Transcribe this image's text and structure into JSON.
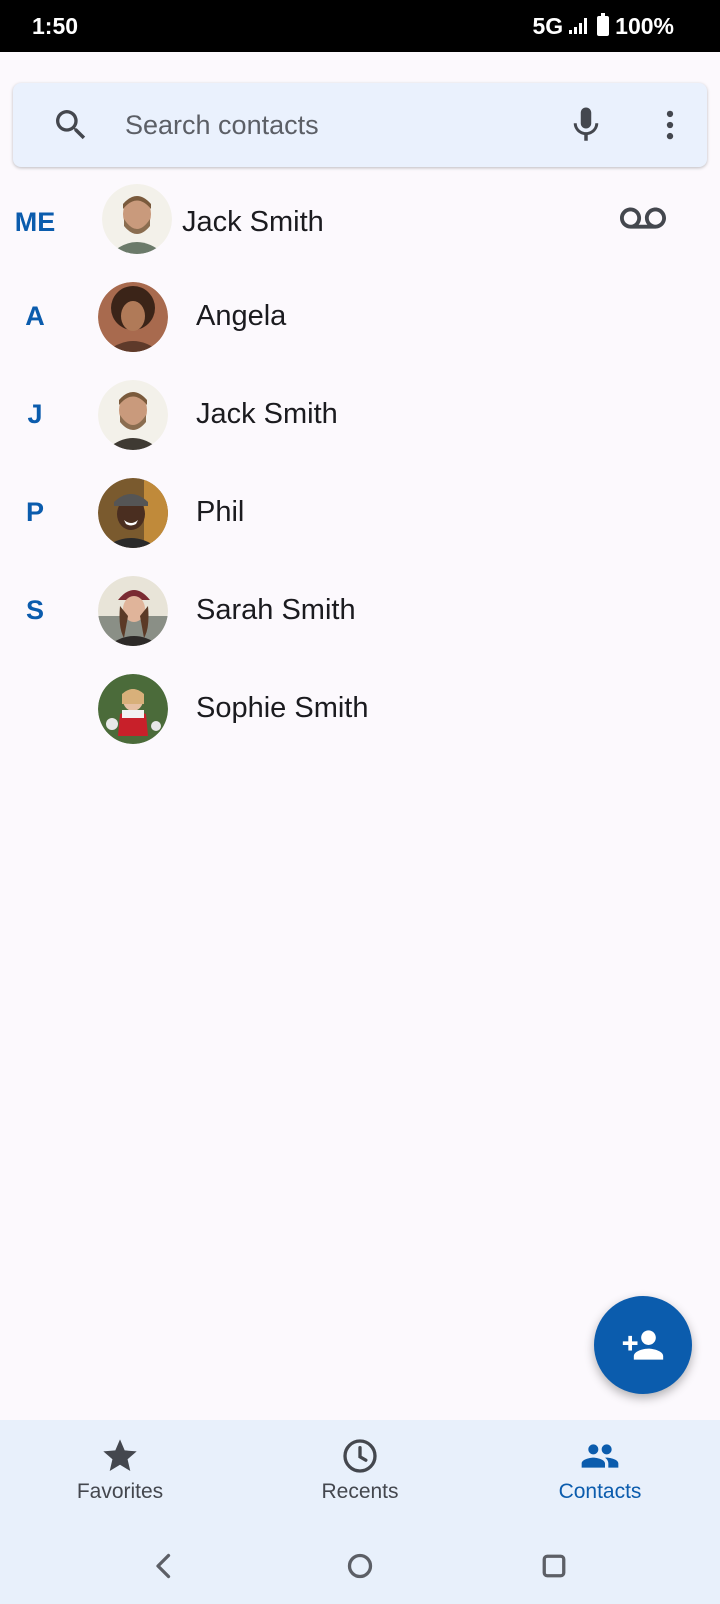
{
  "status_bar": {
    "time": "1:50",
    "network": "5G",
    "battery": "100%"
  },
  "search": {
    "placeholder": "Search contacts"
  },
  "me": {
    "section": "ME",
    "name": "Jack Smith"
  },
  "contacts": [
    {
      "section": "A",
      "name": "Angela"
    },
    {
      "section": "J",
      "name": "Jack Smith"
    },
    {
      "section": "P",
      "name": "Phil"
    },
    {
      "section": "S",
      "name": "Sarah Smith"
    },
    {
      "section": "",
      "name": "Sophie Smith"
    }
  ],
  "bottom_nav": {
    "favorites": "Favorites",
    "recents": "Recents",
    "contacts": "Contacts"
  },
  "colors": {
    "accent": "#0b5cad",
    "background": "#fcf9fd",
    "nav_background": "#e8f0fb"
  }
}
